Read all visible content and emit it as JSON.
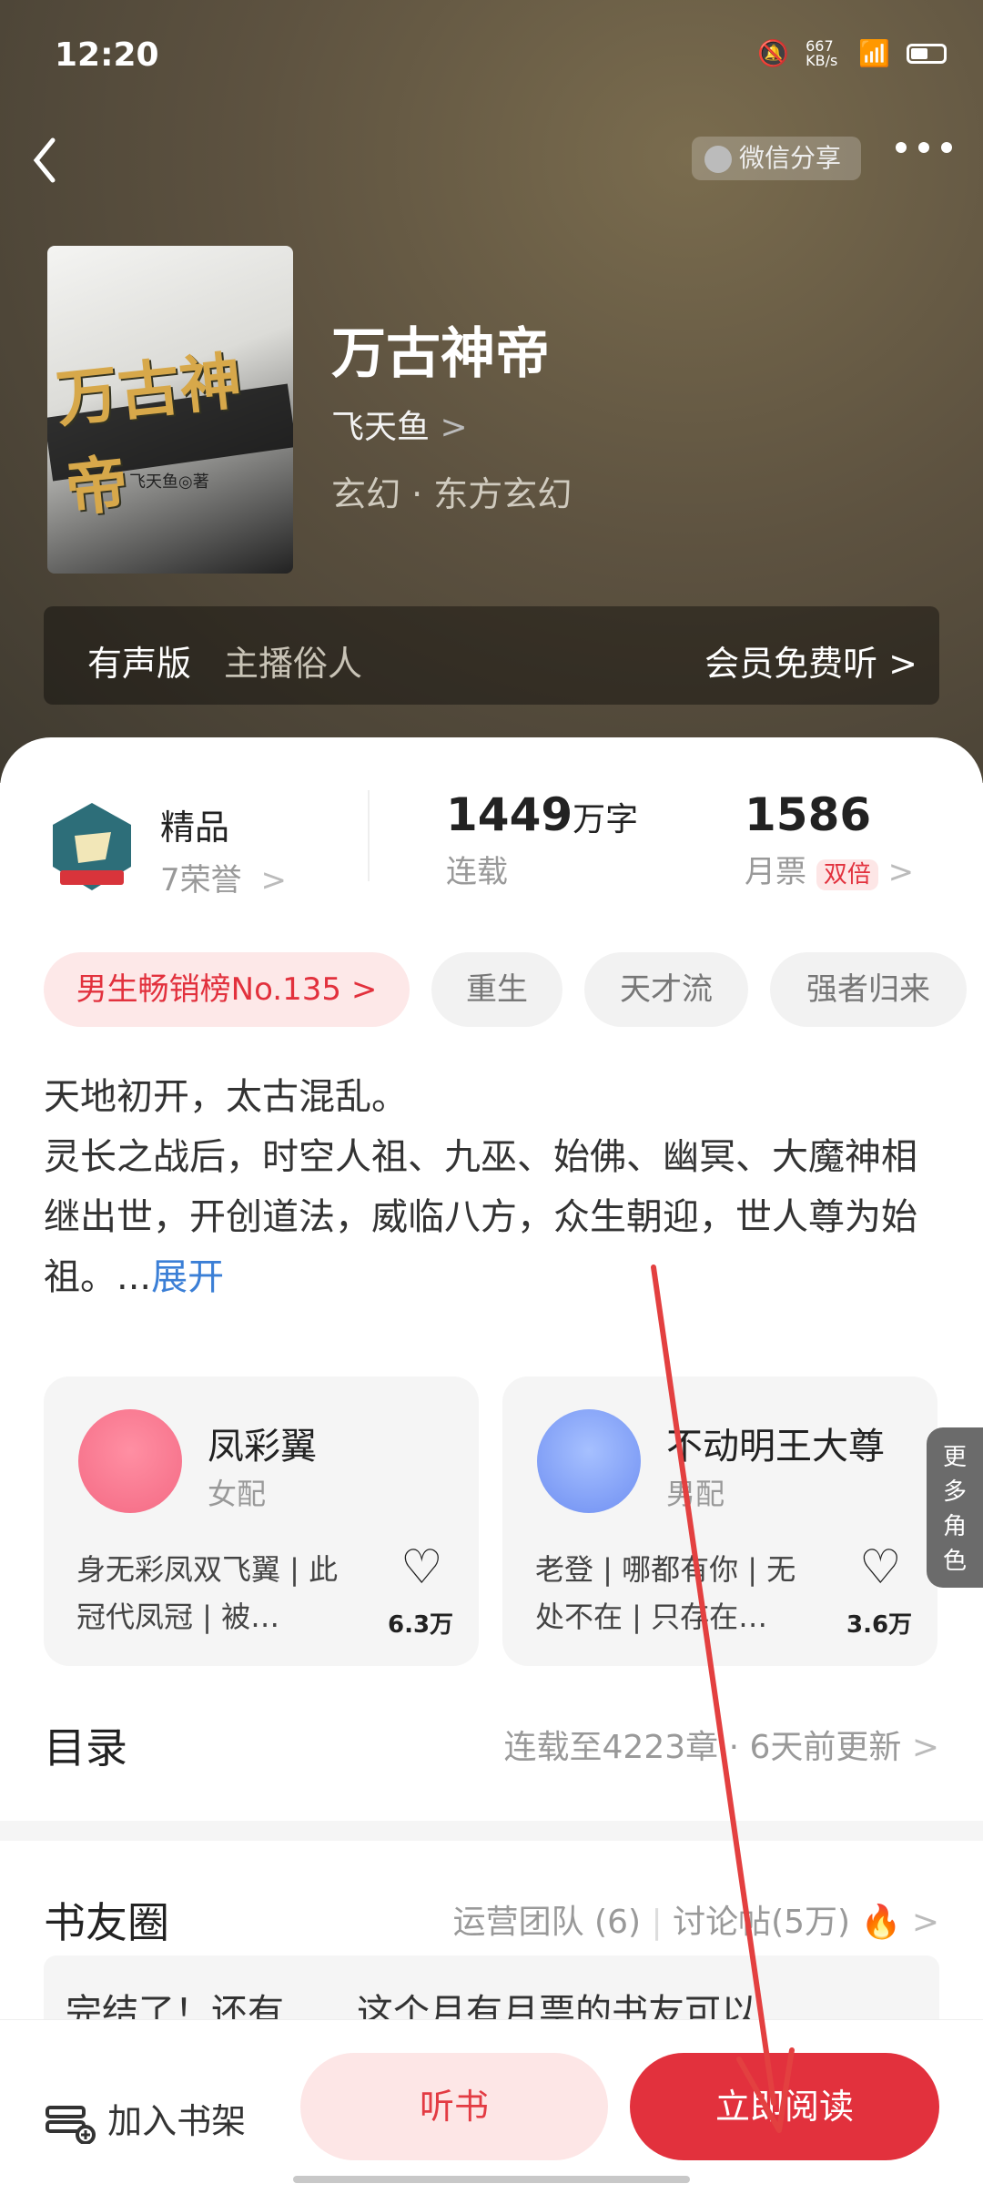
{
  "status": {
    "time": "12:20",
    "net_speed": "667 KB/s"
  },
  "nav": {
    "share_label": "微信分享",
    "back_icon": "chevron-left-icon",
    "more_icon": "more-dots-icon"
  },
  "book": {
    "title": "万古神帝",
    "author": "飞天鱼",
    "author_chevron": ">",
    "genre": "玄幻 · 东方玄幻",
    "cover_title": "万古神帝",
    "cover_author": "飞天鱼◎著"
  },
  "audio": {
    "label": "有声版",
    "narrator": "主播俗人",
    "action": "会员免费听 >"
  },
  "stats": {
    "badge_title": "精品",
    "honors": "7荣誉",
    "words_value": "1449",
    "words_unit": "万字",
    "status": "连载",
    "tickets_value": "1586",
    "tickets_label": "月票",
    "double_badge": "双倍",
    "chevron": ">"
  },
  "tags": [
    "男生畅销榜No.135 >",
    "重生",
    "天才流",
    "强者归来"
  ],
  "description": {
    "line1": "天地初开，太古混乱。",
    "line2": "灵长之战后，时空人祖、九巫、始佛、幽冥、大魔神相继出世，开创道法，威临八方，众生朝迎，世人尊为始祖。...",
    "expand": "展开"
  },
  "characters": [
    {
      "name": "凤彩翼",
      "role": "女配",
      "desc": "身无彩凤双飞翼 | 此冠代凤冠 | 被…",
      "likes": "6.3万"
    },
    {
      "name": "不动明王大尊",
      "role": "男配",
      "desc": "老登 | 哪都有你 | 无处不在 | 只存在…",
      "likes": "3.6万"
    }
  ],
  "more_roles": [
    "更",
    "多",
    "角",
    "色"
  ],
  "toc": {
    "title": "目录",
    "info": "连载至4223章 · 6天前更新",
    "chevron": ">"
  },
  "circle": {
    "title": "书友圈",
    "team": "运营团队 (6)",
    "posts": "讨论帖(5万)",
    "chevron": ">",
    "preview": "完结了！还有……这个月有月票的书友可以…"
  },
  "bottom": {
    "shelf_label": "加入书架",
    "listen_label": "听书",
    "read_label": "立即阅读"
  },
  "colors": {
    "accent_red": "#e2313d",
    "link_blue": "#3b7fd6",
    "header_brown": "#5d5240"
  }
}
